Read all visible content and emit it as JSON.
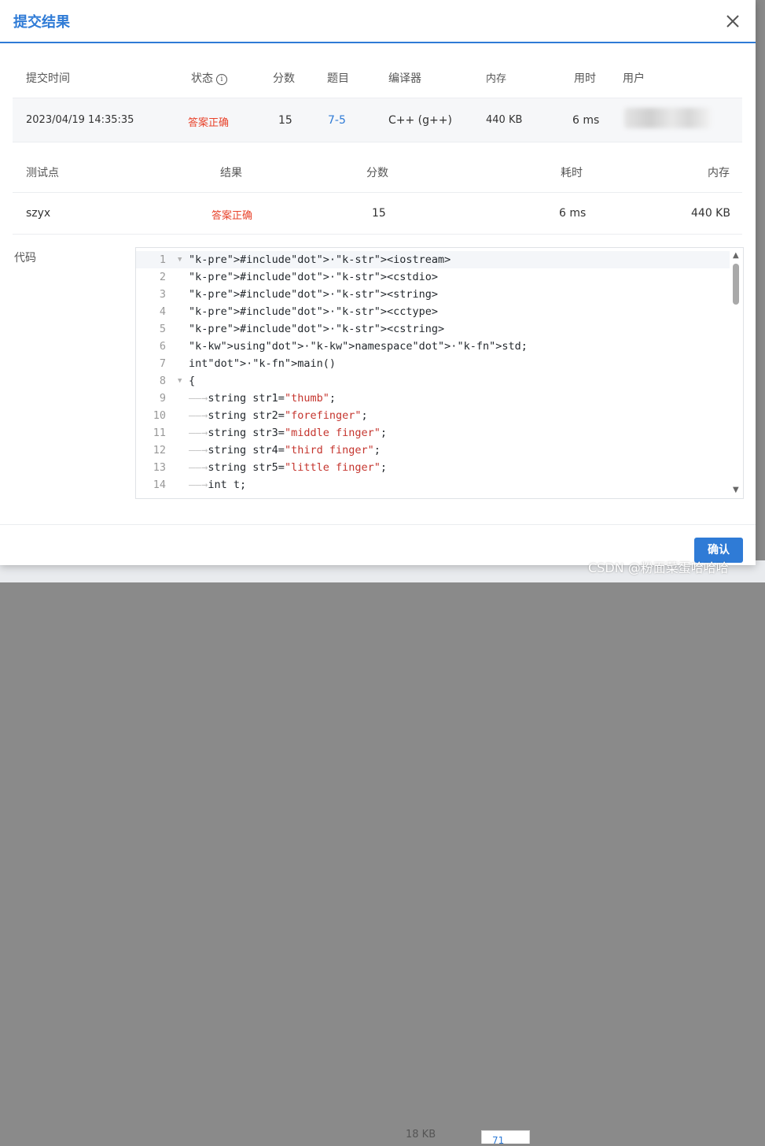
{
  "dialog": {
    "title": "提交结果",
    "confirm_label": "确认"
  },
  "submission": {
    "headers": {
      "time": "提交时间",
      "status": "状态",
      "score": "分数",
      "problem": "题目",
      "compiler": "编译器",
      "memory": "内存",
      "time_used": "用时",
      "user": "用户"
    },
    "row": {
      "time": "2023/04/19 14:35:35",
      "status": "答案正确",
      "score": "15",
      "problem": "7-5",
      "compiler": "C++ (g++)",
      "memory": "440 KB",
      "time_used": "6 ms",
      "user": ""
    }
  },
  "tests": {
    "headers": {
      "point": "测试点",
      "result": "结果",
      "score": "分数",
      "time": "耗时",
      "memory": "内存"
    },
    "rows": [
      {
        "point": "szyx",
        "result": "答案正确",
        "score": "15",
        "time": "6 ms",
        "memory": "440 KB"
      }
    ]
  },
  "code": {
    "label": "代码",
    "lines": [
      "#include <iostream>",
      "#include <cstdio>",
      "#include <string>",
      "#include <cctype>",
      "#include <cstring>",
      "using namespace std;",
      "int main()",
      "{",
      "    string str1=\"thumb\";",
      "    string str2=\"forefinger\";",
      "    string str3=\"middle finger\";",
      "    string str4=\"third finger\";",
      "    string str5=\"little finger\";",
      "    int t;"
    ],
    "line_numbers": [
      "1",
      "2",
      "3",
      "4",
      "5",
      "6",
      "7",
      "8",
      "9",
      "10",
      "11",
      "12",
      "13",
      "14"
    ]
  },
  "background": {
    "kb_text": "18 KB",
    "number": "71"
  },
  "watermark": "CSDN @粉面菜蛋哈哈哈",
  "colors": {
    "accent": "#2f7bd6",
    "success_text": "#e8432b"
  },
  "icons": {
    "close": "close-icon",
    "status_info": "info-circle-icon"
  }
}
